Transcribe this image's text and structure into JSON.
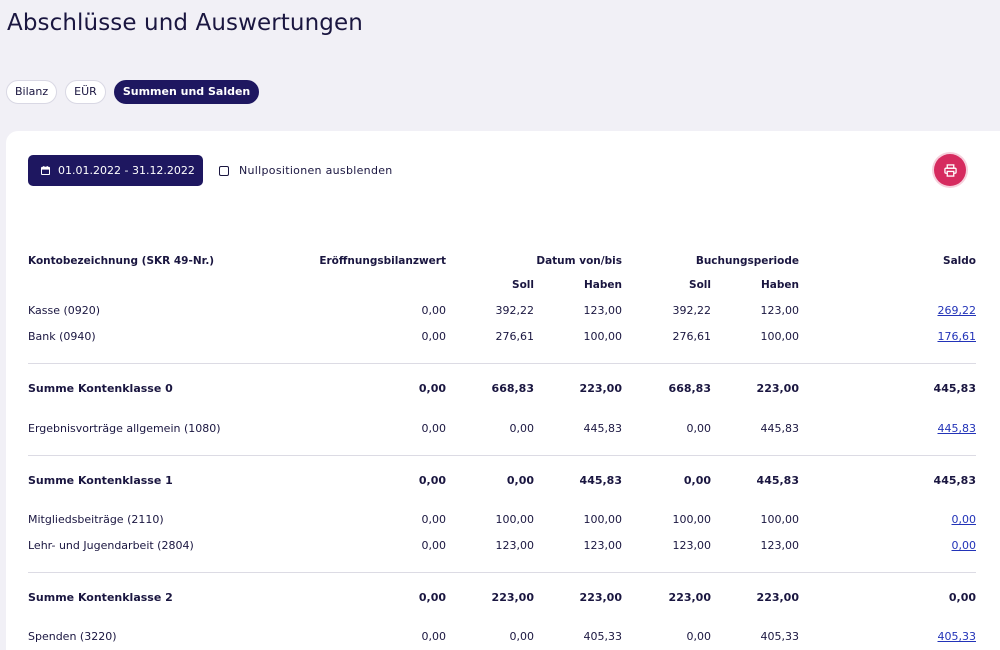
{
  "page": {
    "title": "Abschlüsse und Auswertungen"
  },
  "tabs": [
    {
      "label": "Bilanz",
      "active": false
    },
    {
      "label": "EÜR",
      "active": false
    },
    {
      "label": "Summen und Salden",
      "active": true
    }
  ],
  "toolbar": {
    "date_range": "01.01.2022 - 31.12.2022",
    "hide_zero_label": "Nullpositionen ausblenden",
    "hide_zero_checked": false
  },
  "table": {
    "headers": {
      "account": "Kontobezeichnung (SKR 49-Nr.)",
      "opening": "Eröffnungsbilanzwert",
      "date_range": "Datum von/bis",
      "period": "Buchungsperiode",
      "balance": "Saldo",
      "debit": "Soll",
      "credit": "Haben"
    },
    "rows": [
      {
        "type": "account",
        "name": "Kasse (0920)",
        "opening": "0,00",
        "dr_soll": "392,22",
        "dr_haben": "123,00",
        "bp_soll": "392,22",
        "bp_haben": "123,00",
        "saldo": "269,22"
      },
      {
        "type": "account",
        "name": "Bank (0940)",
        "opening": "0,00",
        "dr_soll": "276,61",
        "dr_haben": "100,00",
        "bp_soll": "276,61",
        "bp_haben": "100,00",
        "saldo": "176,61"
      },
      {
        "type": "sum",
        "name": "Summe Kontenklasse 0",
        "opening": "0,00",
        "dr_soll": "668,83",
        "dr_haben": "223,00",
        "bp_soll": "668,83",
        "bp_haben": "223,00",
        "saldo": "445,83"
      },
      {
        "type": "account",
        "name": "Ergebnisvorträge allgemein (1080)",
        "opening": "0,00",
        "dr_soll": "0,00",
        "dr_haben": "445,83",
        "bp_soll": "0,00",
        "bp_haben": "445,83",
        "saldo": "445,83"
      },
      {
        "type": "sum",
        "name": "Summe Kontenklasse 1",
        "opening": "0,00",
        "dr_soll": "0,00",
        "dr_haben": "445,83",
        "bp_soll": "0,00",
        "bp_haben": "445,83",
        "saldo": "445,83"
      },
      {
        "type": "account",
        "name": "Mitgliedsbeiträge (2110)",
        "opening": "0,00",
        "dr_soll": "100,00",
        "dr_haben": "100,00",
        "bp_soll": "100,00",
        "bp_haben": "100,00",
        "saldo": "0,00"
      },
      {
        "type": "account",
        "name": "Lehr- und Jugendarbeit (2804)",
        "opening": "0,00",
        "dr_soll": "123,00",
        "dr_haben": "123,00",
        "bp_soll": "123,00",
        "bp_haben": "123,00",
        "saldo": "0,00"
      },
      {
        "type": "sum",
        "name": "Summe Kontenklasse 2",
        "opening": "0,00",
        "dr_soll": "223,00",
        "dr_haben": "223,00",
        "bp_soll": "223,00",
        "bp_haben": "223,00",
        "saldo": "0,00"
      },
      {
        "type": "account",
        "name": "Spenden (3220)",
        "opening": "0,00",
        "dr_soll": "0,00",
        "dr_haben": "405,33",
        "bp_soll": "0,00",
        "bp_haben": "405,33",
        "saldo": "405,33"
      }
    ]
  },
  "colors": {
    "primary": "#1e1760",
    "accent": "#d62b5f",
    "link": "#2233b8",
    "background": "#f1f0f6"
  },
  "icons": {
    "date_button": "calendar-icon",
    "print_button": "printer-icon"
  }
}
